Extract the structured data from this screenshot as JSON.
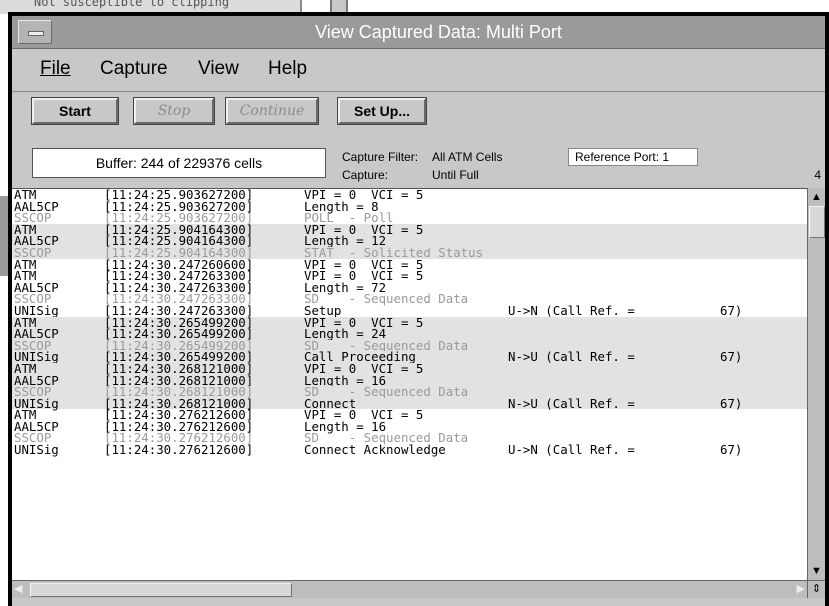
{
  "background": {
    "text": "Not susceptible to clipping"
  },
  "window": {
    "title": "View Captured Data: Multi Port"
  },
  "menu": {
    "file": "File",
    "capture": "Capture",
    "view": "View",
    "help": "Help"
  },
  "toolbar": {
    "start": "Start",
    "stop": "Stop",
    "continue": "Continue",
    "setup": "Set Up..."
  },
  "status": {
    "buffer": "Buffer: 244 of 229376 cells",
    "capture_filter_label": "Capture Filter:",
    "capture_filter_value": "All ATM Cells",
    "capture_label": "Capture:",
    "capture_value": "Until Full",
    "reference_port_label": "Reference Port:",
    "reference_port_value": "1",
    "page": "4"
  },
  "rows": [
    {
      "proto": "ATM",
      "time": "[11:24:25.903627200]",
      "info": "VPI = 0  VCI = 5",
      "dir": "",
      "ref": "",
      "shade": false,
      "gray": false
    },
    {
      "proto": "AAL5CP",
      "time": "[11:24:25.903627200]",
      "info": "Length = 8",
      "dir": "",
      "ref": "",
      "shade": false,
      "gray": false
    },
    {
      "proto": "SSCOP",
      "time": "[11:24:25.903627200]",
      "info": "POLL  - Poll",
      "dir": "",
      "ref": "",
      "shade": false,
      "gray": true
    },
    {
      "proto": "ATM",
      "time": "[11:24:25.904164300]",
      "info": "VPI = 0  VCI = 5",
      "dir": "",
      "ref": "",
      "shade": true,
      "gray": false
    },
    {
      "proto": "AAL5CP",
      "time": "[11:24:25.904164300]",
      "info": "Length = 12",
      "dir": "",
      "ref": "",
      "shade": true,
      "gray": false
    },
    {
      "proto": "SSCOP",
      "time": "[11:24:25.904164300]",
      "info": "STAT  - Solicited Status",
      "dir": "",
      "ref": "",
      "shade": true,
      "gray": true
    },
    {
      "proto": "ATM",
      "time": "[11:24:30.247260600]",
      "info": "VPI = 0  VCI = 5",
      "dir": "",
      "ref": "",
      "shade": false,
      "gray": false
    },
    {
      "proto": "ATM",
      "time": "[11:24:30.247263300]",
      "info": "VPI = 0  VCI = 5",
      "dir": "",
      "ref": "",
      "shade": false,
      "gray": false
    },
    {
      "proto": "AAL5CP",
      "time": "[11:24:30.247263300]",
      "info": "Length = 72",
      "dir": "",
      "ref": "",
      "shade": false,
      "gray": false
    },
    {
      "proto": "SSCOP",
      "time": "[11:24:30.247263300]",
      "info": "SD    - Sequenced Data",
      "dir": "",
      "ref": "",
      "shade": false,
      "gray": true
    },
    {
      "proto": "UNISig",
      "time": "[11:24:30.247263300]",
      "info": "Setup",
      "dir": "U->N (Call Ref. =",
      "ref": "67)",
      "shade": false,
      "gray": false
    },
    {
      "proto": "ATM",
      "time": "[11:24:30.265499200]",
      "info": "VPI = 0  VCI = 5",
      "dir": "",
      "ref": "",
      "shade": true,
      "gray": false
    },
    {
      "proto": "AAL5CP",
      "time": "[11:24:30.265499200]",
      "info": "Length = 24",
      "dir": "",
      "ref": "",
      "shade": true,
      "gray": false
    },
    {
      "proto": "SSCOP",
      "time": "[11:24:30.265499200]",
      "info": "SD    - Sequenced Data",
      "dir": "",
      "ref": "",
      "shade": true,
      "gray": true
    },
    {
      "proto": "UNISig",
      "time": "[11:24:30.265499200]",
      "info": "Call Proceeding",
      "dir": "N->U (Call Ref. =",
      "ref": "67)",
      "shade": true,
      "gray": false
    },
    {
      "proto": "ATM",
      "time": "[11:24:30.268121000]",
      "info": "VPI = 0  VCI = 5",
      "dir": "",
      "ref": "",
      "shade": true,
      "gray": false
    },
    {
      "proto": "AAL5CP",
      "time": "[11:24:30.268121000]",
      "info": "Length = 16",
      "dir": "",
      "ref": "",
      "shade": true,
      "gray": false
    },
    {
      "proto": "SSCOP",
      "time": "[11:24:30.268121000]",
      "info": "SD    - Sequenced Data",
      "dir": "",
      "ref": "",
      "shade": true,
      "gray": true
    },
    {
      "proto": "UNISig",
      "time": "[11:24:30.268121000]",
      "info": "Connect",
      "dir": "N->U (Call Ref. =",
      "ref": "67)",
      "shade": true,
      "gray": false
    },
    {
      "proto": "ATM",
      "time": "[11:24:30.276212600]",
      "info": "VPI = 0  VCI = 5",
      "dir": "",
      "ref": "",
      "shade": false,
      "gray": false
    },
    {
      "proto": "AAL5CP",
      "time": "[11:24:30.276212600]",
      "info": "Length = 16",
      "dir": "",
      "ref": "",
      "shade": false,
      "gray": false
    },
    {
      "proto": "SSCOP",
      "time": "[11:24:30.276212600]",
      "info": "SD    - Sequenced Data",
      "dir": "",
      "ref": "",
      "shade": false,
      "gray": true
    },
    {
      "proto": "UNISig",
      "time": "[11:24:30.276212600]",
      "info": "Connect Acknowledge",
      "dir": "U->N (Call Ref. =",
      "ref": "67)",
      "shade": false,
      "gray": false
    }
  ],
  "icons": {
    "window_menu": "window-menu-icon",
    "scroll_up": "scroll-up-icon",
    "scroll_down": "scroll-down-icon",
    "scroll_left": "scroll-left-icon",
    "scroll_right": "scroll-right-icon"
  },
  "colors": {
    "titlebar": "#9a9a9a",
    "panel": "#c8c8c8",
    "shade_row": "#e2e2e2",
    "gray_text": "#9a9a9a"
  }
}
